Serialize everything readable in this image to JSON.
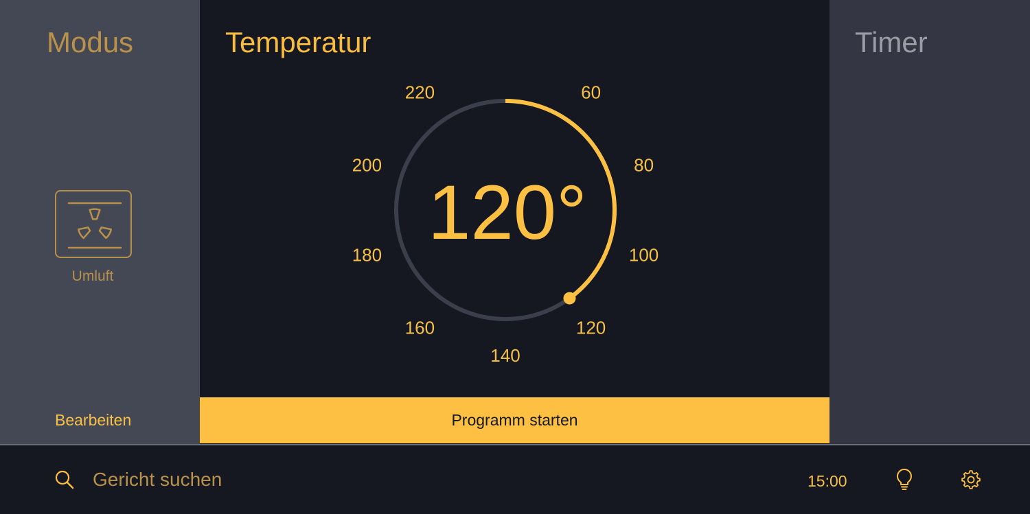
{
  "mode_panel": {
    "title": "Modus",
    "mode": {
      "label": "Umluft",
      "icon": "fan-icon"
    },
    "edit_label": "Bearbeiten"
  },
  "temperature_panel": {
    "title": "Temperatur",
    "value_display": "120°",
    "dial": {
      "value": 120,
      "min": 40,
      "max": 240,
      "scale_labels": [
        "60",
        "80",
        "100",
        "120",
        "140",
        "160",
        "180",
        "200",
        "220"
      ]
    },
    "start_label": "Programm starten"
  },
  "timer_panel": {
    "title": "Timer"
  },
  "bottom_bar": {
    "search_placeholder": "Gericht suchen",
    "time": "15:00",
    "icons": [
      "search-icon",
      "lightbulb-icon",
      "gear-icon"
    ]
  },
  "colors": {
    "accent": "#fec042",
    "accent_muted": "#b8914a",
    "track": "#3b3e4b",
    "panel_left_bg": "#444754",
    "panel_center_bg": "#161821",
    "panel_right_bg": "#343743"
  }
}
